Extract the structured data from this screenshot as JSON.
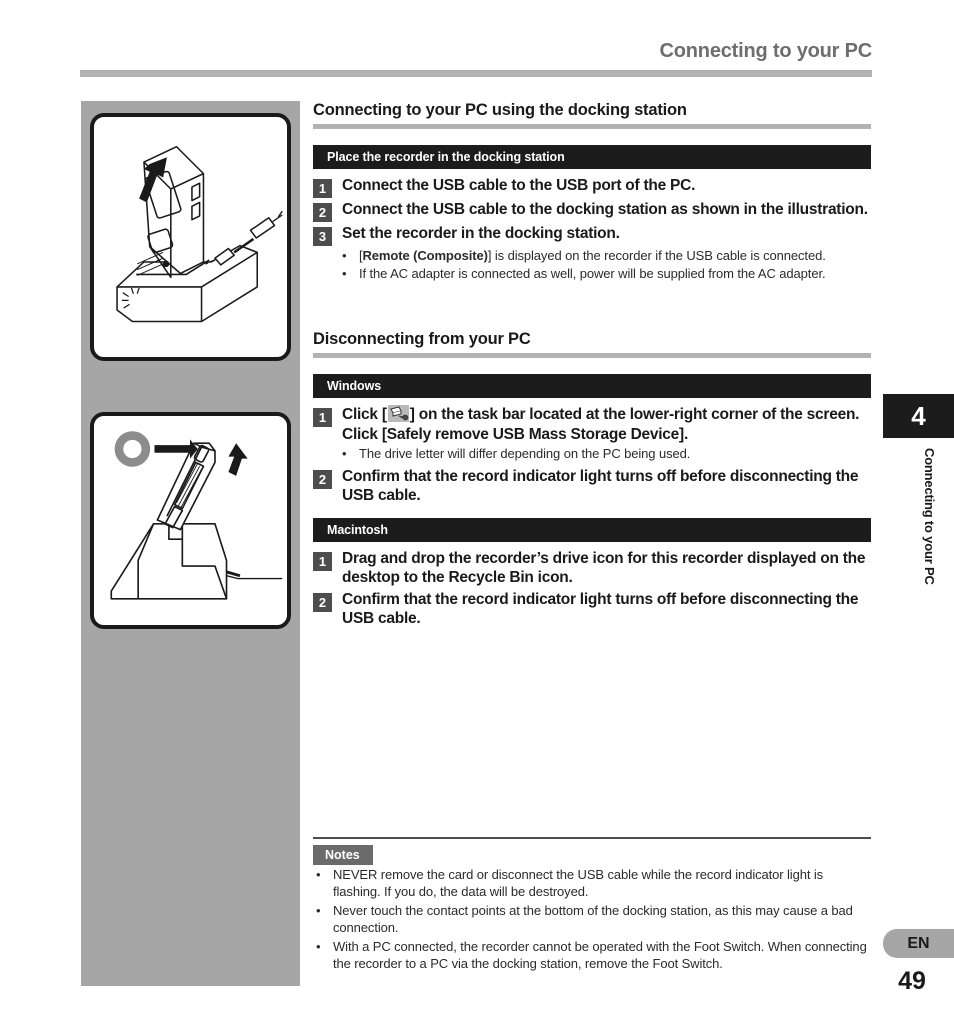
{
  "header": {
    "running_title": "Connecting to your PC"
  },
  "illustrations": [
    {
      "name": "recorder-into-docking-station",
      "caption": ""
    },
    {
      "name": "recorder-removed-from-docking-station",
      "caption": ""
    }
  ],
  "sections": [
    {
      "title": "Connecting to your PC using the docking station",
      "bar_head": "Place the recorder in the docking station",
      "steps": [
        {
          "num": "1",
          "text": "Connect the USB cable to the USB port of the PC.",
          "bullets": []
        },
        {
          "num": "2",
          "text": "Connect the USB cable to the docking station as shown in the illustration.",
          "bullets": []
        },
        {
          "num": "3",
          "text": "Set the recorder in the docking station.",
          "bullets": [
            "[Remote (Composite)] is displayed on the recorder if the USB cable is connected.",
            "If the AC adapter is connected as well, power will be supplied from the AC adapter."
          ]
        }
      ]
    },
    {
      "title": "Disconnecting from your PC",
      "bar_head_windows": "Windows",
      "bar_head_macintosh": "Macintosh",
      "windows_steps": [
        {
          "num": "1",
          "text_before_icon": "Click [",
          "icon": "safely-remove-hardware-icon",
          "text_after_icon": "] on the task bar located at the lower-right corner of the screen. Click [Safely remove USB Mass Storage Device].",
          "bullets": [
            "The drive letter will differ depending on the PC being used."
          ]
        },
        {
          "num": "2",
          "text": "Confirm that the record indicator light turns off before disconnecting the USB cable.",
          "bullets": []
        }
      ],
      "macintosh_steps": [
        {
          "num": "1",
          "text": "Drag and drop the recorder’s drive icon for this recorder displayed on the desktop to the Recycle Bin icon.",
          "bullets": []
        },
        {
          "num": "2",
          "text": "Confirm that the record indicator light turns off before disconnecting the USB cable.",
          "bullets": []
        }
      ]
    }
  ],
  "notes": {
    "label": "Notes",
    "items": [
      "NEVER remove the card or disconnect the USB cable while the record indicator light is flashing. If you do, the data will be destroyed.",
      "Never touch the contact points at the bottom of the docking station, as this may cause a bad connection.",
      "With a PC connected, the recorder cannot be operated with the Foot Switch. When connecting the recorder to a PC via the docking station, remove the Foot Switch."
    ]
  },
  "side_tab": {
    "chapter_number": "4",
    "chapter_title": "Connecting to your PC",
    "language": "EN",
    "page_number": "49"
  },
  "colors": {
    "rule_gray": "#b3b3b3",
    "panel_gray": "#a6a6a6",
    "bar_black": "#1c1c1c",
    "step_badge": "#4d4d4d",
    "notes_badge": "#6b6b6b"
  }
}
